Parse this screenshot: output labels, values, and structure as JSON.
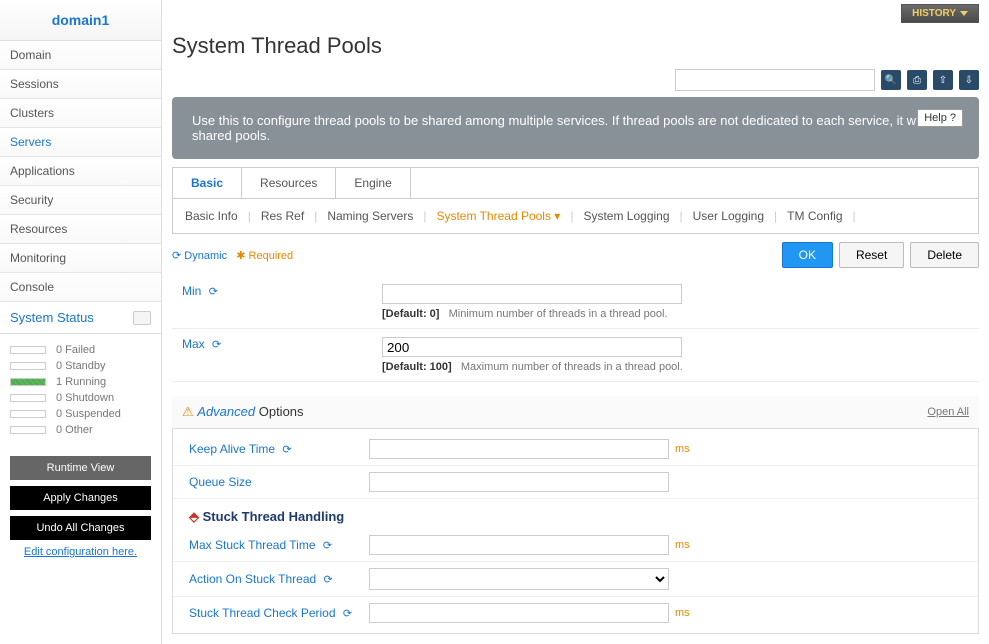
{
  "sidebar": {
    "domain": "domain1",
    "nav": [
      "Domain",
      "Sessions",
      "Clusters",
      "Servers",
      "Applications",
      "Security",
      "Resources",
      "Monitoring",
      "Console"
    ],
    "active_nav_index": 3,
    "status_header": "System Status",
    "status": [
      {
        "count": "0",
        "label": "Failed"
      },
      {
        "count": "0",
        "label": "Standby"
      },
      {
        "count": "1",
        "label": "Running"
      },
      {
        "count": "0",
        "label": "Shutdown"
      },
      {
        "count": "0",
        "label": "Suspended"
      },
      {
        "count": "0",
        "label": "Other"
      }
    ],
    "buttons": {
      "runtime_view": "Runtime View",
      "apply": "Apply Changes",
      "undo": "Undo All Changes"
    },
    "edit_link": "Edit configuration here."
  },
  "topbar": {
    "history": "HISTORY"
  },
  "page": {
    "title": "System Thread Pools",
    "description": "Use this to configure thread pools to be shared among multiple services. If thread pools are not dedicated to each service, it will use shared pools.",
    "help": "Help"
  },
  "icons": {
    "search": "🔍",
    "doc": "⎙",
    "xml_up": "⇧",
    "xml_down": "⇩",
    "help_q": "?",
    "dynamic": "⟳",
    "required": "✱",
    "section": "⬘"
  },
  "tabs": {
    "items": [
      "Basic",
      "Resources",
      "Engine"
    ],
    "active_index": 0
  },
  "subtabs": {
    "items": [
      "Basic Info",
      "Res Ref",
      "Naming Servers",
      "System Thread Pools",
      "System Logging",
      "User Logging",
      "TM Config"
    ],
    "active_index": 3,
    "dropdown_indicator": "▾"
  },
  "legend": {
    "dynamic": "Dynamic",
    "required": "Required"
  },
  "buttons": {
    "ok": "OK",
    "reset": "Reset",
    "delete": "Delete"
  },
  "form": {
    "min": {
      "label": "Min",
      "value": "",
      "default_label": "[Default: 0]",
      "hint": "Minimum number of threads in a thread pool."
    },
    "max": {
      "label": "Max",
      "value": "200",
      "default_label": "[Default: 100]",
      "hint": "Maximum number of threads in a thread pool."
    }
  },
  "advanced": {
    "title_em": "Advanced",
    "title_rest": " Options",
    "open_all": "Open All",
    "keep_alive": {
      "label": "Keep Alive Time",
      "value": "",
      "unit": "ms"
    },
    "queue_size": {
      "label": "Queue Size",
      "value": ""
    },
    "stuck_header": "Stuck Thread Handling",
    "max_stuck": {
      "label": "Max Stuck Thread Time",
      "value": "",
      "unit": "ms"
    },
    "action": {
      "label": "Action On Stuck Thread",
      "value": ""
    },
    "check_period": {
      "label": "Stuck Thread Check Period",
      "value": "",
      "unit": "ms"
    }
  },
  "colors": {
    "primary_blue": "#1976d2",
    "accent_orange": "#e68a00",
    "banner_gray": "#889098"
  }
}
